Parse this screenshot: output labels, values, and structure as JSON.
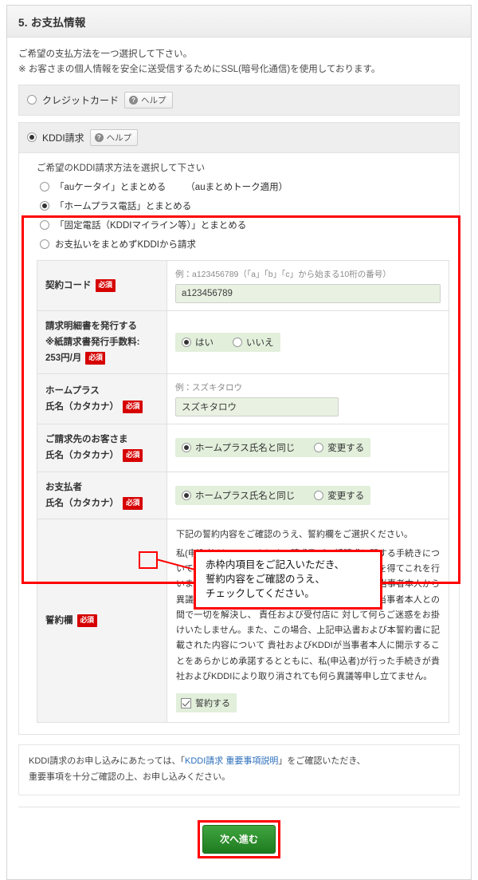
{
  "header": {
    "title": "5. お支払情報"
  },
  "intro": {
    "line1": "ご希望の支払方法を一つ選択して下さい。",
    "line2": "※ お客さまの個人情報を安全に送受信するためにSSL(暗号化通信)を使用しております。"
  },
  "payment_methods": [
    {
      "label": "クレジットカード",
      "selected": false,
      "help_label": "ヘルプ",
      "help_icon": "question-mark-icon"
    },
    {
      "label": "KDDI請求",
      "selected": true,
      "help_label": "ヘルプ",
      "help_icon": "question-mark-icon"
    }
  ],
  "kddi_method": {
    "title": "ご希望のKDDI請求方法を選択して下さい",
    "options": [
      {
        "label": "「auケータイ」とまとめる",
        "suffix": "（auまとめトーク適用）",
        "selected": false
      },
      {
        "label": "「ホームプラス電話」とまとめる",
        "suffix": "",
        "selected": true
      },
      {
        "label": "「固定電話（KDDIマイライン等）」とまとめる",
        "suffix": "",
        "selected": false
      },
      {
        "label": "お支払いをまとめずKDDIから請求",
        "suffix": "",
        "selected": false
      }
    ]
  },
  "required_badge": "必須",
  "fields": {
    "contract_code": {
      "label": "契約コード",
      "hint": "例：a123456789（「a」「b」「c」から始まる10桁の番号）",
      "value": "a123456789"
    },
    "statement_issue": {
      "label_line1": "請求明細書を発行する",
      "label_line2": "※紙請求書発行手数料:",
      "label_line3": "253円/月",
      "options": [
        {
          "label": "はい",
          "selected": true
        },
        {
          "label": "いいえ",
          "selected": false
        }
      ]
    },
    "homeplus_name": {
      "label_line1": "ホームプラス",
      "label_line2": "氏名（カタカナ）",
      "hint": "例：スズキタロウ",
      "value": "スズキタロウ"
    },
    "billing_customer": {
      "label_line1": "ご請求先のお客さま",
      "label_line2": "氏名（カタカナ）",
      "options": [
        {
          "label": "ホームプラス氏名と同じ",
          "selected": true
        },
        {
          "label": "変更する",
          "selected": false
        }
      ]
    },
    "payer": {
      "label_line1": "お支払者",
      "label_line2": "氏名（カタカナ）",
      "options": [
        {
          "label": "ホームプラス氏名と同じ",
          "selected": true
        },
        {
          "label": "変更する",
          "selected": false
        }
      ]
    },
    "pledge": {
      "label": "誓約欄",
      "lead": "下記の誓約内容をご確認のうえ、誓約欄をご選択ください。",
      "body": "私(申込者)は、KDDIまとめて請求及び一括請求に関する手続きについて、当該申込みに関係する当事者から必要な承諾を得てこれを行います。 なお、私 (申込者)が行った手続きについて当事者本人から異議等の申し立てがあった場合には、私(申込者)と当事者本人との間で一切を解決し、 責任および受付店に 対して何らご迷惑をお掛けいたしません。また、この場合、上記申込書および本誓約書に記載された内容について 貴社およびKDDIが当事者本人に開示することをあらかじめ承諾するとともに、私(申込者)が行った手続きが貴社およびKDDIにより取り消されても何ら異議等申し立てません。",
      "checkbox_label": "誓約する",
      "checked": true
    }
  },
  "callout": {
    "text": "赤枠内項目をご記入いただき、\n誓約内容をご確認のうえ、\nチェックしてください。"
  },
  "footer_note": {
    "prefix": "KDDI請求のお申し込みにあたっては、「",
    "link": "KDDI請求 重要事項説明",
    "middle": "」をご確認いただき、",
    "line2": "重要事項を十分ご確認の上、お申し込みください。"
  },
  "submit": {
    "label": "次へ進む"
  },
  "colors": {
    "highlight_red": "#ff0000",
    "required_red": "#d60000",
    "submit_green": "#2f8f2f",
    "input_green": "#e9f2e2",
    "link_blue": "#2a6ebb"
  }
}
